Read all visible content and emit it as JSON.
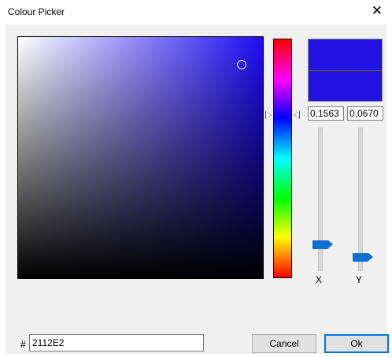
{
  "window": {
    "title": "Colour Picker",
    "close_glyph": "✕"
  },
  "picker": {
    "hex_prefix": "#",
    "hex_value": "2112E2",
    "preview_color": "#2112E2",
    "x_value": "0,1563",
    "y_value": "0,0670",
    "x_label": "X",
    "y_label": "Y",
    "x_slider_level": 0.1563,
    "y_slider_level": 0.067
  },
  "buttons": {
    "cancel": "Cancel",
    "ok": "Ok"
  },
  "icons": {
    "close": "close-icon",
    "hue_left": "hue-pointer-left-icon",
    "hue_right": "hue-pointer-right-icon",
    "sv_marker": "saturation-value-marker-icon"
  }
}
